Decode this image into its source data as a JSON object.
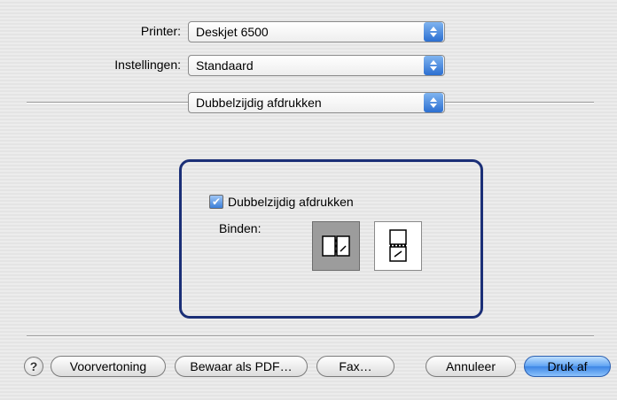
{
  "printer": {
    "label": "Printer:",
    "value": "Deskjet 6500"
  },
  "presets": {
    "label": "Instellingen:",
    "value": "Standaard"
  },
  "panel": {
    "value": "Dubbelzijdig afdrukken"
  },
  "duplex": {
    "checkbox_label": "Dubbelzijdig afdrukken",
    "checked": true,
    "binding_label": "Binden:",
    "binding_options": [
      {
        "name": "long-edge",
        "selected": true
      },
      {
        "name": "short-edge",
        "selected": false
      }
    ]
  },
  "buttons": {
    "help": "?",
    "preview": "Voorvertoning",
    "save_pdf": "Bewaar als PDF…",
    "fax": "Fax…",
    "cancel": "Annuleer",
    "print": "Druk af"
  },
  "colors": {
    "group_border": "#1b2f77",
    "accent": "#3d86e6"
  }
}
